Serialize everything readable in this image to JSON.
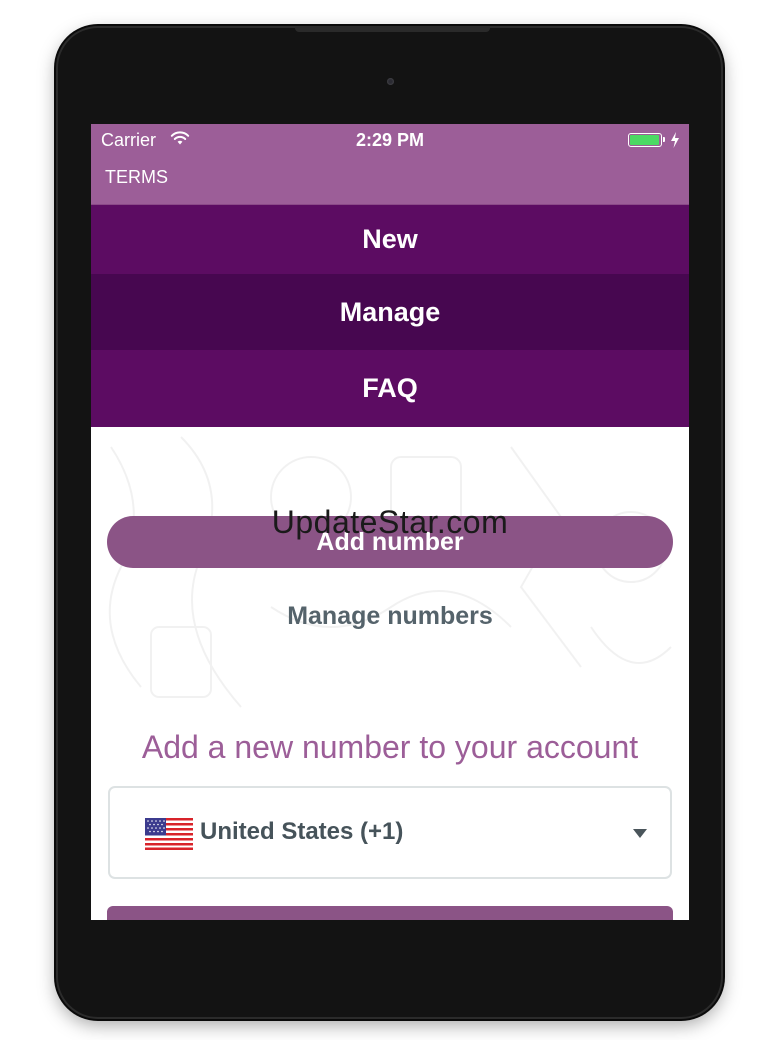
{
  "status_bar": {
    "carrier": "Carrier",
    "time": "2:29 PM",
    "battery_color": "#4cd964"
  },
  "nav": {
    "terms_label": "TERMS"
  },
  "menu": {
    "items": [
      {
        "label": "New"
      },
      {
        "label": "Manage"
      },
      {
        "label": "FAQ"
      }
    ]
  },
  "watermark": "UpdateStar.com",
  "main": {
    "add_button_label": "Add number",
    "manage_link_label": "Manage numbers",
    "headline": "Add a new number to your account",
    "country_select": {
      "value": "United States (+1)",
      "flag_icon": "us-flag-icon"
    }
  },
  "colors": {
    "header": "#9c5e98",
    "menu_primary": "#5c0c62",
    "menu_active": "#470750",
    "button": "#8b5486",
    "text_muted": "#55636b"
  }
}
